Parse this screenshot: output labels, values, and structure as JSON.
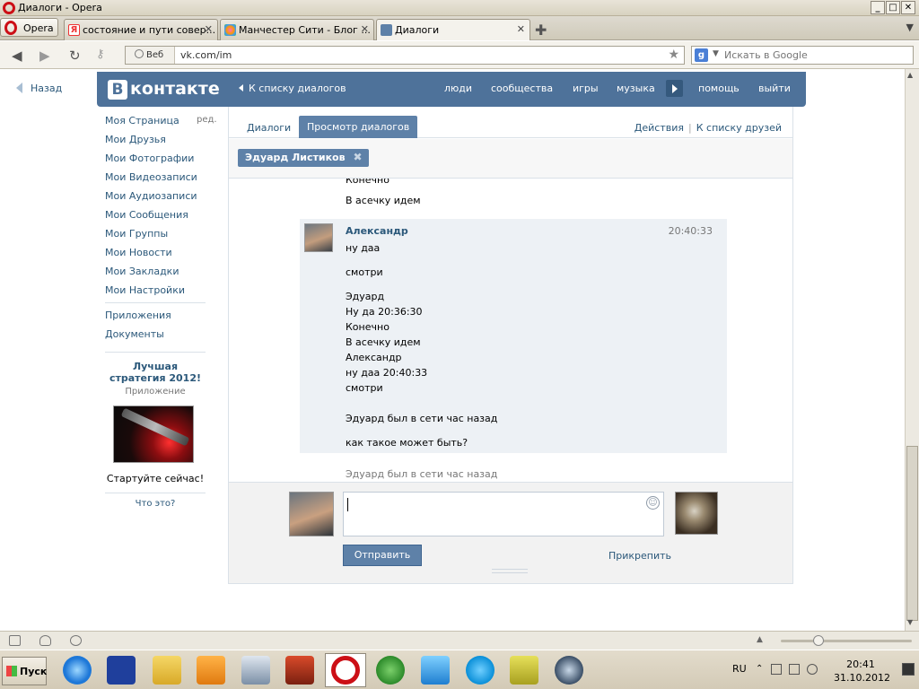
{
  "window": {
    "title": "Диалоги - Opera",
    "controls": [
      "_",
      "□",
      "✕"
    ]
  },
  "browser": {
    "menu_label": "Opera",
    "tabs": [
      {
        "label": "состояние и пути совер...",
        "icon": "yandex-icon",
        "active": false
      },
      {
        "label": "Манчестер Сити - Блог ...",
        "icon": "flower-icon",
        "active": false
      },
      {
        "label": "Диалоги",
        "icon": "vk-icon",
        "active": true
      }
    ],
    "address": {
      "web_label": "Веб",
      "url": "vk.com/im"
    },
    "search": {
      "placeholder": "Искать в Google"
    }
  },
  "vk": {
    "back_label": "Назад",
    "logo_letter": "В",
    "logo_text": "контакте",
    "to_dialogs_list": "К списку диалогов",
    "nav": [
      "люди",
      "сообщества",
      "игры",
      "музыка",
      "помощь",
      "выйти"
    ],
    "left_menu": {
      "edit_label": "ред.",
      "items": [
        "Моя Страница",
        "Мои Друзья",
        "Мои Фотографии",
        "Мои Видеозаписи",
        "Мои Аудиозаписи",
        "Мои Сообщения",
        "Мои Группы",
        "Мои Новости",
        "Мои Закладки",
        "Мои Настройки"
      ],
      "extra": [
        "Приложения",
        "Документы"
      ],
      "ad": {
        "title": "Лучшая стратегия 2012!",
        "subtitle": "Приложение",
        "cta": "Стартуйте сейчас!",
        "what": "Что это?"
      }
    },
    "tabs": {
      "dialogs": "Диалоги",
      "view": "Просмотр диалогов"
    },
    "actions": {
      "actions_label": "Действия",
      "sep": "|",
      "friends_label": "К списку друзей"
    },
    "peer_tag": "Эдуард Листиков",
    "chat": {
      "prev_lines": [
        "Конечно",
        "В асечку идем"
      ],
      "message": {
        "author": "Александр",
        "time": "20:40:33",
        "lines": [
          "ну даа",
          "смотри",
          "Эдуард",
          "Ну да 20:36:30",
          "Конечно",
          "В асечку идем",
          "Александр",
          "ну даа 20:40:33",
          "смотри",
          "Эдуард был в сети час назад",
          "как такое может быть?"
        ]
      },
      "status": "Эдуард был в сети час назад"
    },
    "composer": {
      "send_label": "Отправить",
      "attach_label": "Прикрепить"
    }
  },
  "taskbar": {
    "start_label": "Пуск",
    "lang": "RU",
    "time": "20:41",
    "date": "31.10.2012"
  },
  "colors": {
    "vk_header": "#4e729a",
    "vk_link": "#2b587a",
    "vk_button": "#5e81a8",
    "message_bg": "#edf1f5",
    "opera_red": "#cc0f16"
  }
}
